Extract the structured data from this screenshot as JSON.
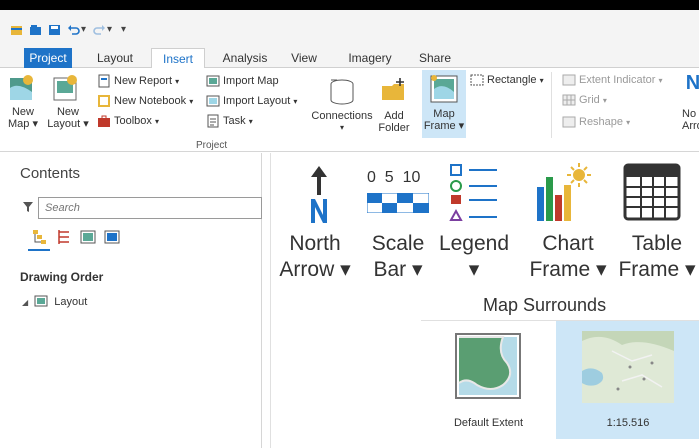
{
  "quick_access": {
    "icons": [
      "new-project-icon",
      "open-project-icon",
      "save-project-icon",
      "undo-icon",
      "redo-icon",
      "customize-icon"
    ]
  },
  "tabs": [
    {
      "label": "Project"
    },
    {
      "label": "Layout"
    },
    {
      "label": "Insert",
      "active": true
    },
    {
      "label": "Analysis"
    },
    {
      "label": "View"
    },
    {
      "label": "Imagery"
    },
    {
      "label": "Share"
    }
  ],
  "ribbon": {
    "new_map": [
      "New",
      "Map ▾"
    ],
    "new_layout": [
      "New",
      "Layout ▾"
    ],
    "new_report": "New Report",
    "new_notebook": "New Notebook",
    "toolbox": "Toolbox",
    "import_map": "Import Map",
    "import_layout": "Import Layout",
    "task": "Task",
    "connections": "Connections",
    "add_folder": [
      "Add",
      "Folder"
    ],
    "project_group": "Project",
    "map_frame": [
      "Map",
      "Frame ▾"
    ],
    "rectangle": "Rectangle",
    "extent_indicator": "Extent Indicator",
    "grid": "Grid",
    "reshape": "Reshape",
    "no_partial": "No",
    "arr_partial": "Arro"
  },
  "contents": {
    "title": "Contents",
    "search_placeholder": "Search",
    "drawing_order": "Drawing Order",
    "layout_item": "Layout"
  },
  "map_surrounds": {
    "title": "Map Surrounds",
    "scale_ticks": [
      "0",
      "5",
      "10"
    ],
    "items": [
      {
        "line1": "North",
        "line2": "Arrow ▾"
      },
      {
        "line1": "Scale",
        "line2": "Bar ▾"
      },
      {
        "line1": "Legend",
        "line2": "▾"
      },
      {
        "line1": "Chart",
        "line2": "Frame ▾"
      },
      {
        "line1": "Table",
        "line2": "Frame ▾"
      }
    ],
    "gallery": [
      {
        "caption": "Default Extent",
        "selected": false
      },
      {
        "caption": "1:15.516",
        "selected": true
      }
    ]
  },
  "colors": {
    "accent": "#1e73c8",
    "selected_thumb": "#cde6f7"
  }
}
